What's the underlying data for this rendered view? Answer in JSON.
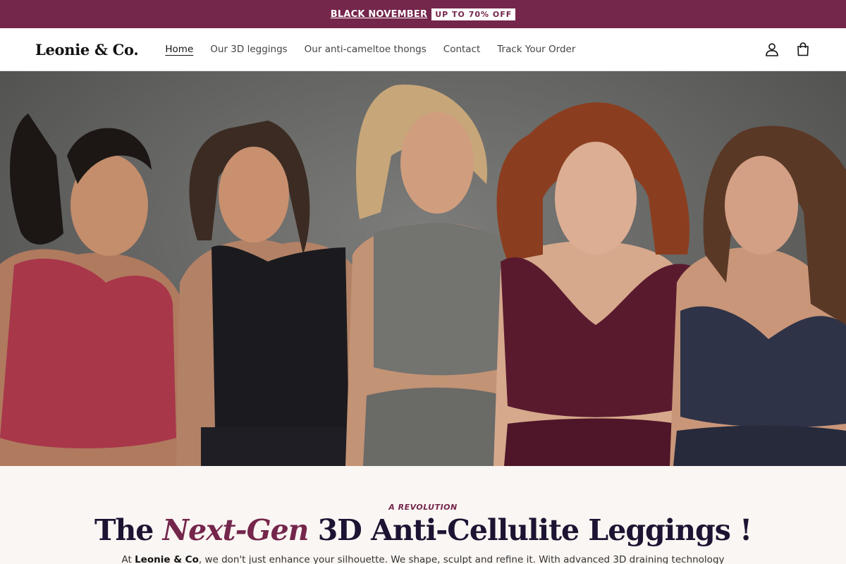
{
  "announcement": {
    "link_text": "BLACK NOVEMBER",
    "badge_text": "UP TO 70% OFF",
    "bg_color": "#74264b"
  },
  "header": {
    "logo": "Leonie & Co.",
    "nav": [
      {
        "label": "Home",
        "active": true
      },
      {
        "label": "Our 3D leggings",
        "active": false
      },
      {
        "label": "Our anti-cameltoe thongs",
        "active": false
      },
      {
        "label": "Contact",
        "active": false
      },
      {
        "label": "Track Your Order",
        "active": false
      }
    ],
    "icons": [
      "account-icon",
      "cart-icon"
    ]
  },
  "hero": {
    "image_alt": "Five smiling women in sports bras and crop tops"
  },
  "intro": {
    "eyebrow": "A REVOLUTION",
    "headline_pre": "The ",
    "headline_accent": "Next-Gen",
    "headline_post": " 3D Anti-Cellulite Leggings !",
    "desc_pre": "At ",
    "desc_brand": "Leonie & Co",
    "desc_post": ", we don't just enhance your silhouette. We shape, sculpt and refine it. With advanced 3D draining technology",
    "accent_color": "#74264b",
    "heading_color": "#1d1433"
  }
}
